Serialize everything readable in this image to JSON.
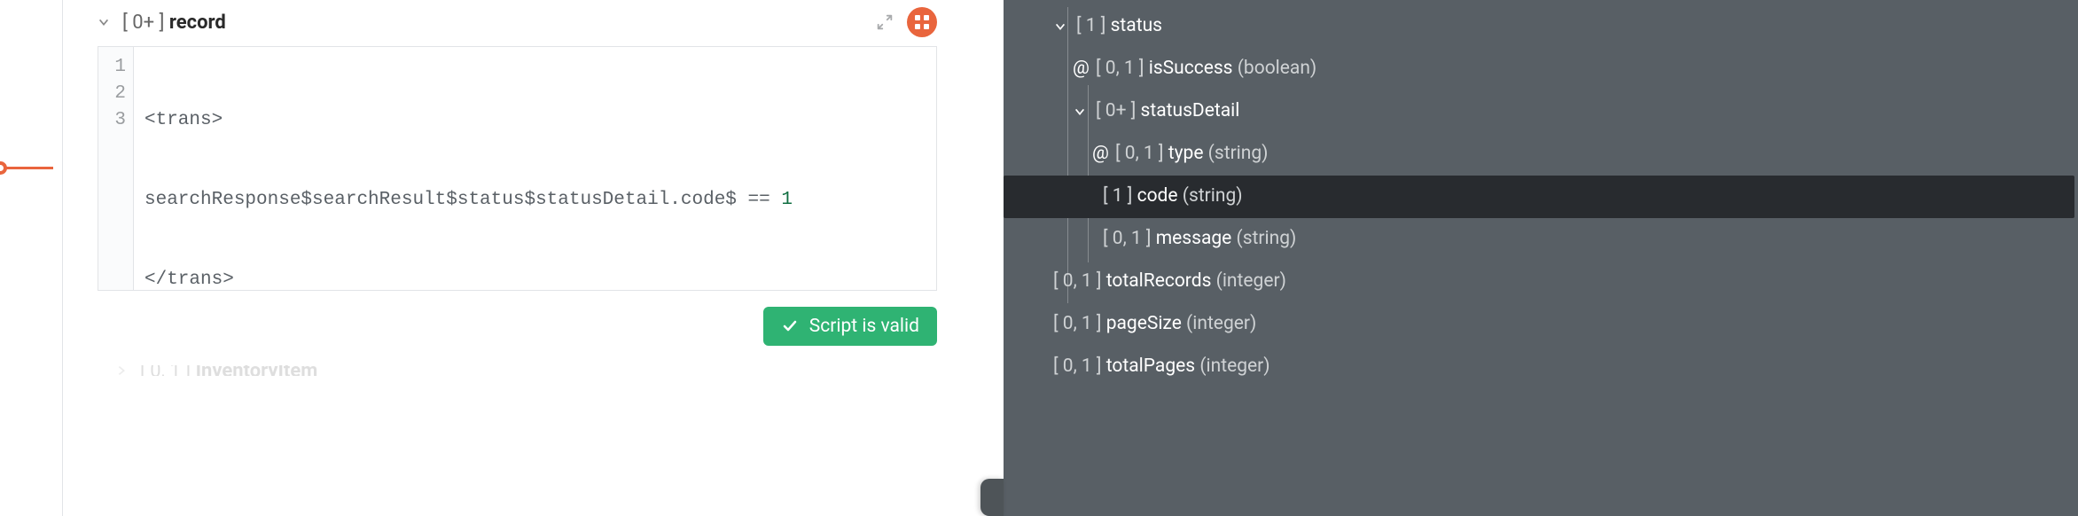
{
  "editor": {
    "header_card": "[ 0+ ]",
    "header_name": "record",
    "lines": {
      "l1": "<trans>",
      "l2_a": "searchResponse$searchResult$status$statusDetail.code$ == ",
      "l2_b": "1",
      "l3": "</trans>"
    },
    "gutter": [
      "1",
      "2",
      "3"
    ],
    "status": "Script is valid",
    "next_card": "[ 0, 1 ]",
    "next_name": "InventoryItem"
  },
  "tree": {
    "n0": {
      "card": "[ 1 ]",
      "name": "status"
    },
    "n1": {
      "at": "@",
      "card": "[ 0, 1 ]",
      "name": "isSuccess",
      "type": "(boolean)"
    },
    "n2": {
      "card": "[ 0+ ]",
      "name": "statusDetail"
    },
    "n3": {
      "at": "@",
      "card": "[ 0, 1 ]",
      "name": "type",
      "type": "(string)"
    },
    "n4": {
      "card": "[ 1 ]",
      "name": "code",
      "type": "(string)"
    },
    "n5": {
      "card": "[ 0, 1 ]",
      "name": "message",
      "type": "(string)"
    },
    "n6": {
      "card": "[ 0, 1 ]",
      "name": "totalRecords",
      "type": "(integer)"
    },
    "n7": {
      "card": "[ 0, 1 ]",
      "name": "pageSize",
      "type": "(integer)"
    },
    "n8": {
      "card": "[ 0, 1 ]",
      "name": "totalPages",
      "type": "(integer)"
    }
  }
}
